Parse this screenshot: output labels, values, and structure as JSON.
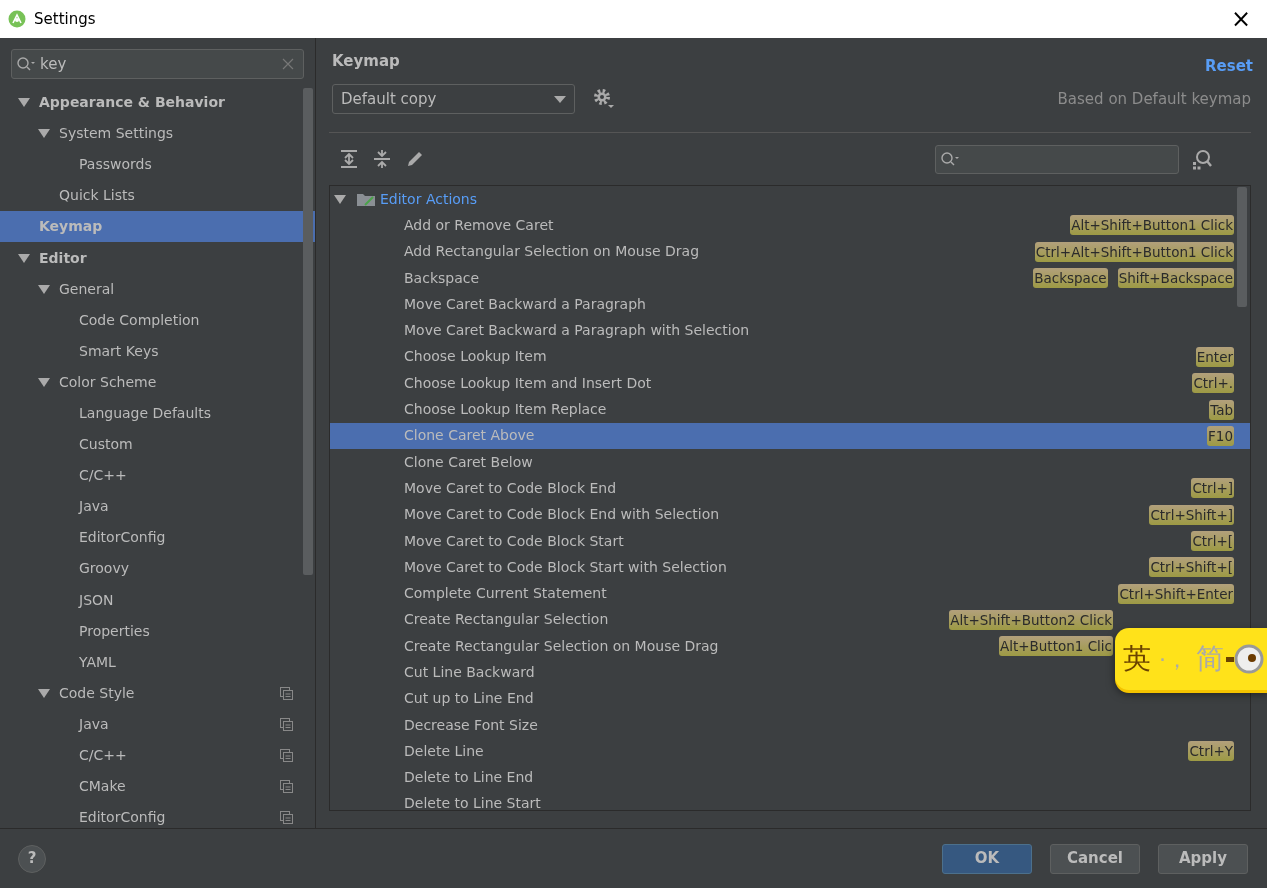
{
  "window": {
    "title": "Settings",
    "close": "×"
  },
  "sidebar": {
    "search": {
      "value": "key"
    },
    "items": [
      {
        "label": "Appearance & Behavior",
        "expanded": true,
        "selected": false,
        "children": [
          {
            "label": "System Settings",
            "expanded": true,
            "selected": false,
            "children": [
              {
                "label": "Passwords",
                "selected": false
              }
            ]
          },
          {
            "label": "Quick Lists",
            "selected": false
          }
        ]
      },
      {
        "label": "Keymap",
        "selected": true
      },
      {
        "label": "Editor",
        "expanded": true,
        "selected": false,
        "children": [
          {
            "label": "General",
            "expanded": true,
            "selected": false,
            "children": [
              {
                "label": "Code Completion",
                "selected": false
              },
              {
                "label": "Smart Keys",
                "selected": false
              }
            ]
          },
          {
            "label": "Color Scheme",
            "expanded": true,
            "selected": false,
            "children": [
              {
                "label": "Language Defaults",
                "selected": false
              },
              {
                "label": "Custom",
                "selected": false
              },
              {
                "label": "C/C++",
                "selected": false
              },
              {
                "label": "Java",
                "selected": false
              },
              {
                "label": "EditorConfig",
                "selected": false
              },
              {
                "label": "Groovy",
                "selected": false
              },
              {
                "label": "JSON",
                "selected": false
              },
              {
                "label": "Properties",
                "selected": false
              },
              {
                "label": "YAML",
                "selected": false
              }
            ]
          },
          {
            "label": "Code Style",
            "expanded": true,
            "selected": false,
            "copy_icon": true,
            "children": [
              {
                "label": "Java",
                "selected": false,
                "copy_icon": true
              },
              {
                "label": "C/C++",
                "selected": false,
                "copy_icon": true
              },
              {
                "label": "CMake",
                "selected": false,
                "copy_icon": true
              },
              {
                "label": "EditorConfig",
                "selected": false,
                "copy_icon": true
              }
            ]
          }
        ]
      }
    ]
  },
  "panel": {
    "title": "Keymap",
    "reset": "Reset",
    "keymap": "Default copy",
    "based_on": "Based on Default keymap",
    "tree": {
      "label": "Editor Actions",
      "expanded": true,
      "actions": [
        {
          "label": "Add or Remove Caret",
          "selected": false,
          "shortcuts": [
            "Alt+Shift+Button1 Click"
          ]
        },
        {
          "label": "Add Rectangular Selection on Mouse Drag",
          "selected": false,
          "shortcuts": [
            "Ctrl+Alt+Shift+Button1 Click"
          ]
        },
        {
          "label": "Backspace",
          "selected": false,
          "shortcuts": [
            "Backspace",
            "Shift+Backspace"
          ]
        },
        {
          "label": "Move Caret Backward a Paragraph",
          "selected": false
        },
        {
          "label": "Move Caret Backward a Paragraph with Selection",
          "selected": false
        },
        {
          "label": "Choose Lookup Item",
          "selected": false,
          "shortcuts": [
            "Enter"
          ]
        },
        {
          "label": "Choose Lookup Item and Insert Dot",
          "selected": false,
          "shortcuts": [
            "Ctrl+."
          ]
        },
        {
          "label": "Choose Lookup Item Replace",
          "selected": false,
          "shortcuts": [
            "Tab"
          ]
        },
        {
          "label": "Clone Caret Above",
          "selected": true,
          "shortcuts": [
            "F10"
          ]
        },
        {
          "label": "Clone Caret Below",
          "selected": false
        },
        {
          "label": "Move Caret to Code Block End",
          "selected": false,
          "shortcuts": [
            "Ctrl+]"
          ]
        },
        {
          "label": "Move Caret to Code Block End with Selection",
          "selected": false,
          "shortcuts": [
            "Ctrl+Shift+]"
          ]
        },
        {
          "label": "Move Caret to Code Block Start",
          "selected": false,
          "shortcuts": [
            "Ctrl+["
          ]
        },
        {
          "label": "Move Caret to Code Block Start with Selection",
          "selected": false,
          "shortcuts": [
            "Ctrl+Shift+["
          ]
        },
        {
          "label": "Complete Current Statement",
          "selected": false,
          "shortcuts": [
            "Ctrl+Shift+Enter"
          ]
        },
        {
          "label": "Create Rectangular Selection",
          "selected": false,
          "shortcuts": [
            "Alt+Shift+Button2 Click"
          ]
        },
        {
          "label": "Create Rectangular Selection on Mouse Drag",
          "selected": false,
          "shortcuts": [
            "Alt+Button1 Clic"
          ]
        },
        {
          "label": "Cut Line Backward",
          "selected": false
        },
        {
          "label": "Cut up to Line End",
          "selected": false
        },
        {
          "label": "Decrease Font Size",
          "selected": false
        },
        {
          "label": "Delete Line",
          "selected": false,
          "shortcuts": [
            "Ctrl+Y"
          ]
        },
        {
          "label": "Delete to Line End",
          "selected": false
        },
        {
          "label": "Delete to Line Start",
          "selected": false
        }
      ]
    }
  },
  "ime_toolbar": {
    "mode": "英",
    "punctuation": "·，",
    "script": "简"
  },
  "footer": {
    "help": "?",
    "buttons": [
      {
        "label": "OK",
        "kind": "primary"
      },
      {
        "label": "Cancel",
        "kind": "normal"
      },
      {
        "label": "Apply",
        "kind": "normal"
      }
    ]
  }
}
